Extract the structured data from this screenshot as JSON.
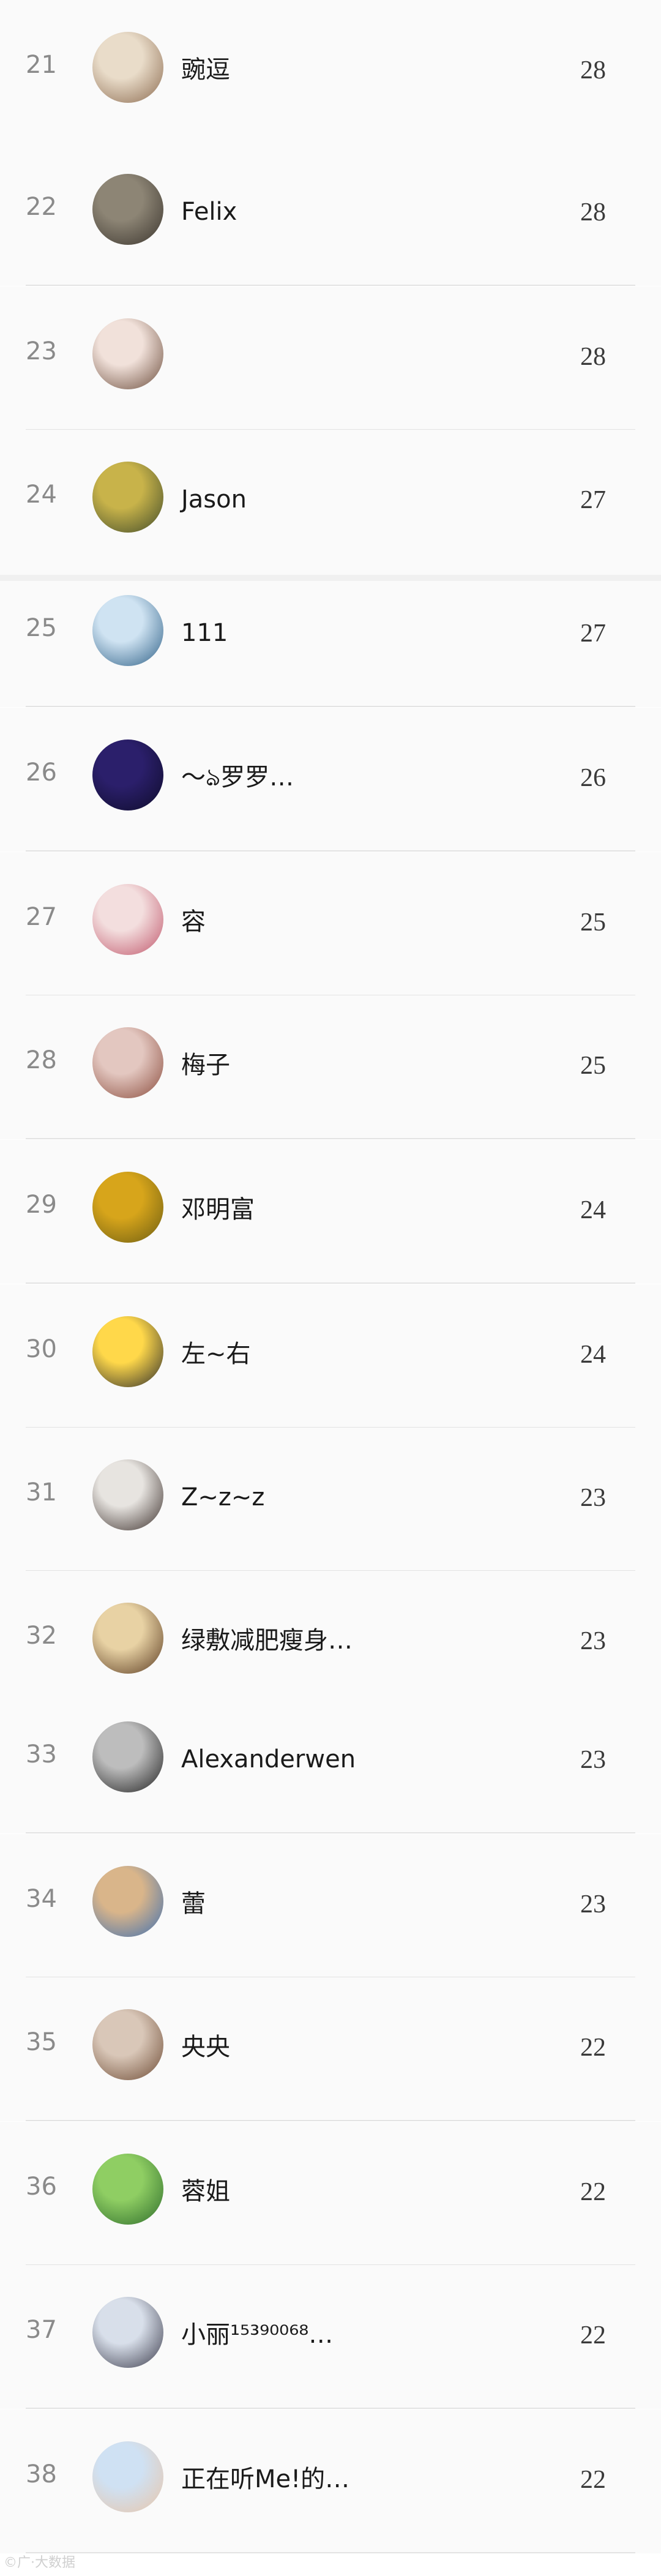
{
  "leaderboard": {
    "rows": [
      {
        "rank": "21",
        "name": "豌逗",
        "score": "28",
        "avatar_icon": "cat-avatar-icon",
        "avatar_colors": [
          "#e9dcc9",
          "#8b6a4f"
        ]
      },
      {
        "rank": "22",
        "name": "Felix",
        "score": "28",
        "avatar_icon": "cat-avatar-icon",
        "avatar_colors": [
          "#8d8575",
          "#3a342d"
        ]
      },
      {
        "rank": "23",
        "name": "",
        "score": "28",
        "avatar_icon": "person-avatar-icon",
        "avatar_colors": [
          "#f1e1da",
          "#6b4c3b"
        ]
      },
      {
        "rank": "24",
        "name": "Jason",
        "score": "27",
        "avatar_icon": "family-avatar-icon",
        "avatar_colors": [
          "#c8b34a",
          "#3f4a2a"
        ]
      },
      {
        "rank": "25",
        "name": "111",
        "score": "27",
        "avatar_icon": "person-avatar-icon",
        "avatar_colors": [
          "#cfe3f2",
          "#2d5f86"
        ]
      },
      {
        "rank": "26",
        "name": "〜ঌ罗罗…",
        "score": "26",
        "avatar_icon": "night-scene-avatar-icon",
        "avatar_colors": [
          "#2b1f6b",
          "#0e0c2a"
        ]
      },
      {
        "rank": "27",
        "name": "容",
        "score": "25",
        "avatar_icon": "flower-avatar-icon",
        "avatar_colors": [
          "#f3dede",
          "#c0556a"
        ]
      },
      {
        "rank": "28",
        "name": "梅子",
        "score": "25",
        "avatar_icon": "person-avatar-icon",
        "avatar_colors": [
          "#e3c7c0",
          "#8a4b3c"
        ]
      },
      {
        "rank": "29",
        "name": "邓明富",
        "score": "24",
        "avatar_icon": "flower-field-avatar-icon",
        "avatar_colors": [
          "#d7a51b",
          "#6b5c12"
        ]
      },
      {
        "rank": "30",
        "name": "左~右",
        "score": "24",
        "avatar_icon": "minion-avatar-icon",
        "avatar_colors": [
          "#ffd84a",
          "#2b2b2b"
        ]
      },
      {
        "rank": "31",
        "name": "Z~z~z",
        "score": "23",
        "avatar_icon": "plush-toy-avatar-icon",
        "avatar_colors": [
          "#e7e4e0",
          "#3a2e2a"
        ]
      },
      {
        "rank": "32",
        "name": "绿敷减肥瘦身…",
        "score": "23",
        "avatar_icon": "person-avatar-icon",
        "avatar_colors": [
          "#e8d2a4",
          "#5a3a20"
        ]
      },
      {
        "rank": "33",
        "name": "Alexanderwen",
        "score": "23",
        "avatar_icon": "bw-photo-avatar-icon",
        "avatar_colors": [
          "#bdbdbd",
          "#1e1e1e"
        ]
      },
      {
        "rank": "34",
        "name": "蕾",
        "score": "23",
        "avatar_icon": "toy-avatar-icon",
        "avatar_colors": [
          "#d9b58a",
          "#3e6fb0"
        ]
      },
      {
        "rank": "35",
        "name": "央央",
        "score": "22",
        "avatar_icon": "object-avatar-icon",
        "avatar_colors": [
          "#d9c7b8",
          "#6d4a33"
        ]
      },
      {
        "rank": "36",
        "name": "蓉姐",
        "score": "22",
        "avatar_icon": "cartoon-avatar-icon",
        "avatar_colors": [
          "#8fce63",
          "#2d6b2b"
        ]
      },
      {
        "rank": "37",
        "name": "小丽¹⁵³⁹⁰⁰⁶⁸…",
        "score": "22",
        "avatar_icon": "person-avatar-icon",
        "avatar_colors": [
          "#d8dfea",
          "#3a3a4a"
        ]
      },
      {
        "rank": "38",
        "name": "正在听Me!的…",
        "score": "22",
        "avatar_icon": "person-avatar-icon",
        "avatar_colors": [
          "#cfe1f3",
          "#e8c5a9"
        ]
      }
    ]
  },
  "footer": {
    "watermark": "©广·大数据"
  }
}
